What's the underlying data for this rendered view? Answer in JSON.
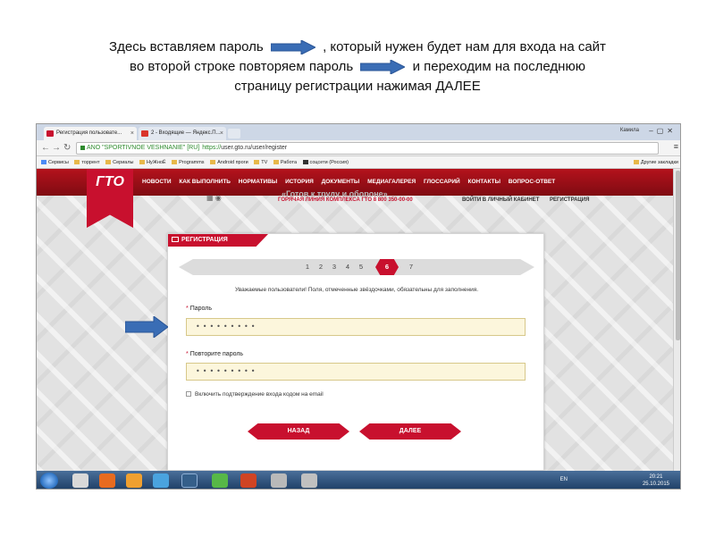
{
  "caption": {
    "line1_a": "Здесь вставляем пароль",
    "line1_b": ", который нужен будет нам для входа на сайт",
    "line2_a": "во второй строке повторяем пароль",
    "line2_b": "и переходим на последнюю",
    "line3": "страницу регистрации нажимая ДАЛЕЕ"
  },
  "browser": {
    "tabs": [
      {
        "label": "Регистрация пользовате..."
      },
      {
        "label": "2 - Входящие — Яндекс.П..."
      }
    ],
    "user_name": "Камила",
    "ev_label": "ANO \"SPORTIVNOE VESHNANIE\" [RU]",
    "url_scheme": "https://",
    "url": "user.gto.ru/user/register",
    "bookmarks": [
      "Сервисы",
      "торрент",
      "Сериалы",
      "НуЖноЁ",
      "Programms",
      "Android проги",
      "TV",
      "Работа",
      "соцсети (Россия)"
    ],
    "bookmarks_right": "Другие закладки"
  },
  "site": {
    "logo": "ГТО",
    "menu": [
      "НОВОСТИ",
      "КАК ВЫПОЛНИТЬ",
      "НОРМАТИВЫ",
      "ИСТОРИЯ",
      "ДОКУМЕНТЫ",
      "МЕДИАГАЛЕРЕЯ",
      "ГЛОССАРИЙ",
      "КОНТАКТЫ",
      "ВОПРОС-ОТВЕТ"
    ],
    "slogan": "«Готов к труду и обороне»",
    "hotline": "ГОРЯЧАЯ ЛИНИЯ КОМПЛЕКСА ГТО 8 800 350-00-00",
    "top_links": [
      "ВОЙТИ В ЛИЧНЫЙ КАБИНЕТ",
      "РЕГИСТРАЦИЯ"
    ]
  },
  "form": {
    "title": "РЕГИСТРАЦИЯ",
    "steps": [
      "1",
      "2",
      "3",
      "4",
      "5",
      "6",
      "7"
    ],
    "current_step": 6,
    "notice": "Уважаемые пользователи! Поля, отмеченные звёздочками, обязательны для заполнения.",
    "required_mark": "*",
    "password_label": "Пароль",
    "password_value": "•••••••••",
    "repeat_label": "Повторите пароль",
    "repeat_value": "•••••••••",
    "checkbox_label": "Включить подтверждение входа кодом на email",
    "back_label": "НАЗАД",
    "next_label": "ДАЛЕЕ"
  },
  "taskbar": {
    "lang": "EN",
    "time": "20:21",
    "date": "25.10.2015"
  },
  "colors": {
    "brand_red": "#c8102e",
    "arrow_blue": "#3a6db5",
    "input_bg": "#fcf6dc"
  }
}
